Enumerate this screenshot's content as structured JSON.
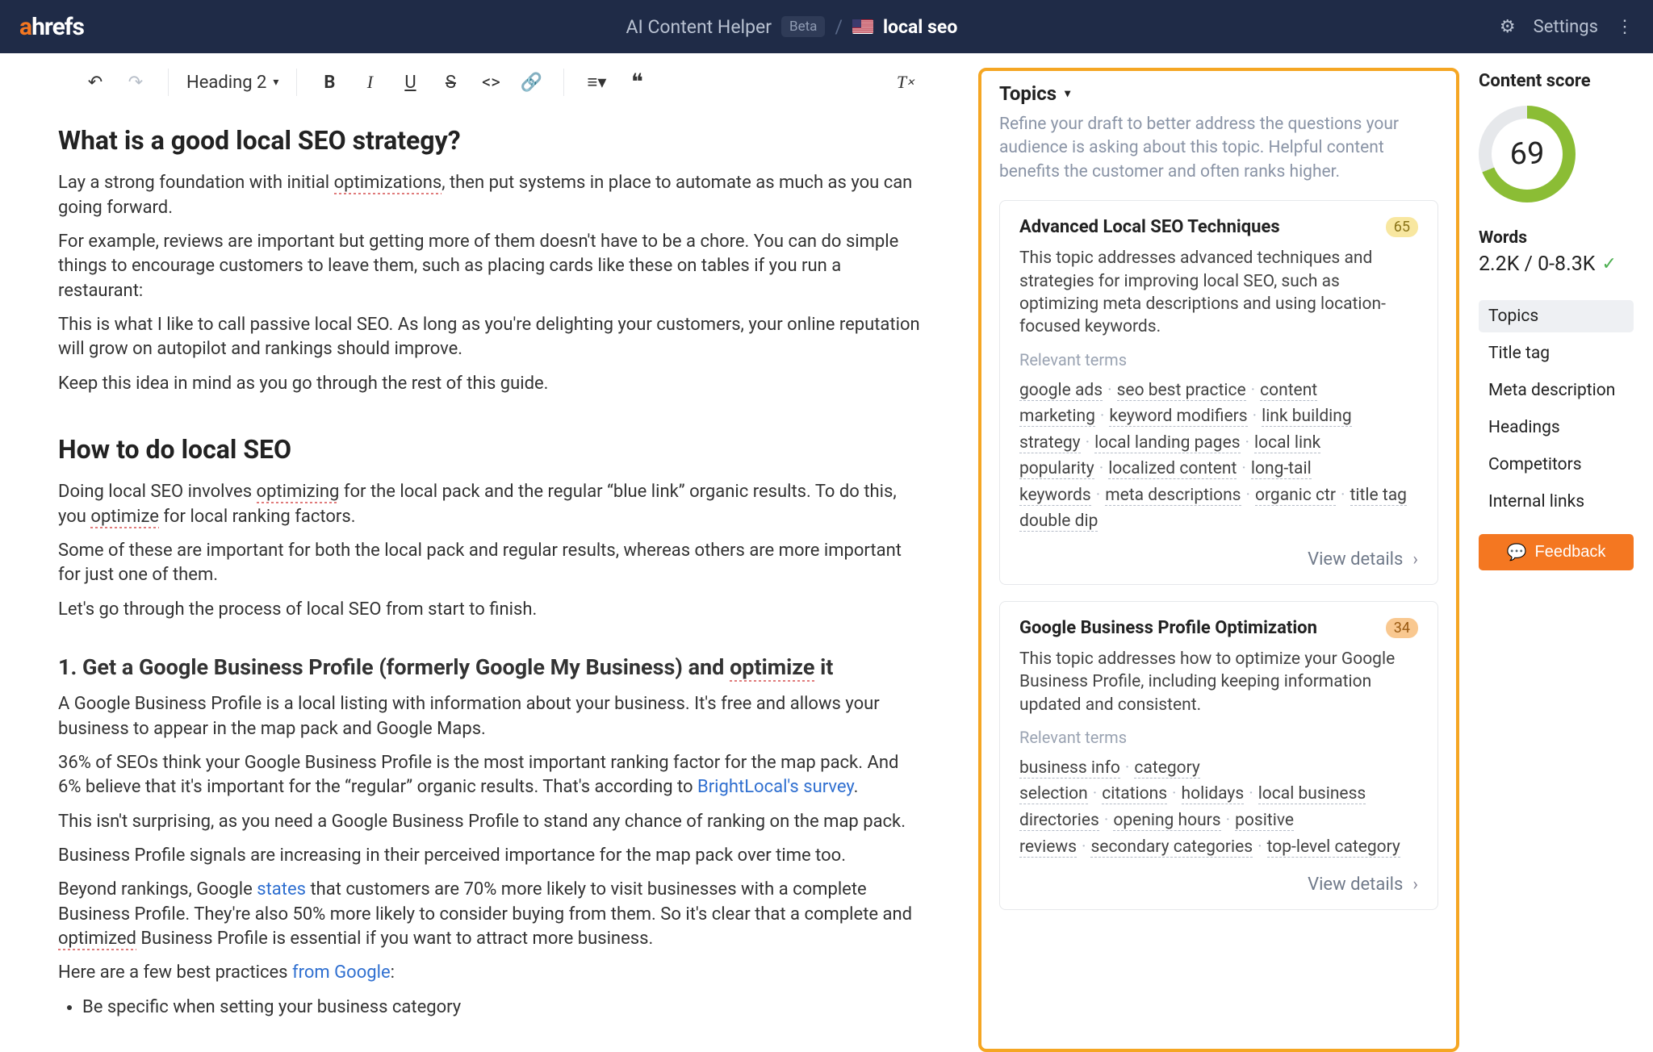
{
  "header": {
    "appName": "AI Content Helper",
    "beta": "Beta",
    "docTitle": "local seo",
    "settings": "Settings"
  },
  "toolbar": {
    "headingLabel": "Heading 2"
  },
  "doc": {
    "h1": "What is a good local SEO strategy?",
    "p1a": "Lay a strong foundation with initial ",
    "p1b": "optimizations",
    "p1c": ", then put systems in place to automate as much as you can going forward.",
    "p2": "For example, reviews are important but getting more of them doesn't have to be a chore. You can do simple things to encourage customers to leave them, such as placing cards like these on tables if you run a restaurant:",
    "p3": "This is what I like to call passive local SEO. As long as you're delighting your customers, your online reputation will grow on autopilot and rankings should improve.",
    "p4": "Keep this idea in mind as you go through the rest of this guide.",
    "h2": "How to do local SEO",
    "p5a": "Doing local SEO involves ",
    "p5b": "optimizing",
    "p5c": " for the local pack and the regular “blue link” organic results. To do this, you ",
    "p5d": "optimize",
    "p5e": " for local ranking factors.",
    "p6": "Some of these are important for both the local pack and regular results, whereas others are more important for just one of them.",
    "p7": "Let's go through the process of local SEO from start to finish.",
    "h3a": "1. Get a Google Business Profile (formerly Google My Business) and ",
    "h3b": "optimize",
    "h3c": " it",
    "p8": "A Google Business Profile is a local listing with information about your business. It's free and allows your business to appear in the map pack and Google Maps.",
    "p9a": "36% of SEOs think your Google Business Profile is the most important ranking factor for the map pack. And 6% believe that it's important for the “regular” organic results. That's according to ",
    "p9b": "BrightLocal's survey",
    "p9c": ".",
    "p10": "This isn't surprising, as you need a Google Business Profile to stand any chance of ranking on the map pack.",
    "p11": "Business Profile signals are increasing in their perceived importance for the map pack over time too.",
    "p12a": "Beyond rankings, Google ",
    "p12b": "states",
    "p12c": " that customers are 70% more likely to visit businesses with a complete Business Profile. They're also 50% more likely to consider buying from them. So it's clear that a complete and ",
    "p12d": "optimized",
    "p12e": " Business Profile is essential if you want to attract more business.",
    "p13a": "Here are a few best practices ",
    "p13b": "from Google",
    "p13c": ":",
    "li1": "Be specific when setting your business category"
  },
  "topics": {
    "heading": "Topics",
    "subtitle": "Refine your draft to better address the questions your audience is asking about this topic. Helpful content benefits the customer and often ranks higher.",
    "cards": [
      {
        "title": "Advanced Local SEO Techniques",
        "score": "65",
        "desc": "This topic addresses advanced techniques and strategies for improving local SEO, such as optimizing meta descriptions and using location-focused keywords.",
        "relLabel": "Relevant terms",
        "terms": [
          "google ads",
          "seo best practice",
          "content marketing",
          "keyword modifiers",
          "link building strategy",
          "local landing pages",
          "local link popularity",
          "localized content",
          "long-tail keywords",
          "meta descriptions",
          "organic ctr",
          "title tag double dip"
        ],
        "viewDetails": "View details"
      },
      {
        "title": "Google Business Profile Optimization",
        "score": "34",
        "desc": "This topic addresses how to optimize your Google Business Profile, including keeping information updated and consistent.",
        "relLabel": "Relevant terms",
        "terms": [
          "business info",
          "category selection",
          "citations",
          "holidays",
          "local business directories",
          "opening hours",
          "positive reviews",
          "secondary categories",
          "top-level category"
        ],
        "viewDetails": "View details"
      }
    ]
  },
  "score": {
    "title": "Content score",
    "value": "69",
    "wordsLabel": "Words",
    "wordsValue": "2.2K / 0-8.3K",
    "nav": [
      "Topics",
      "Title tag",
      "Meta description",
      "Headings",
      "Competitors",
      "Internal links"
    ],
    "feedback": "Feedback"
  }
}
